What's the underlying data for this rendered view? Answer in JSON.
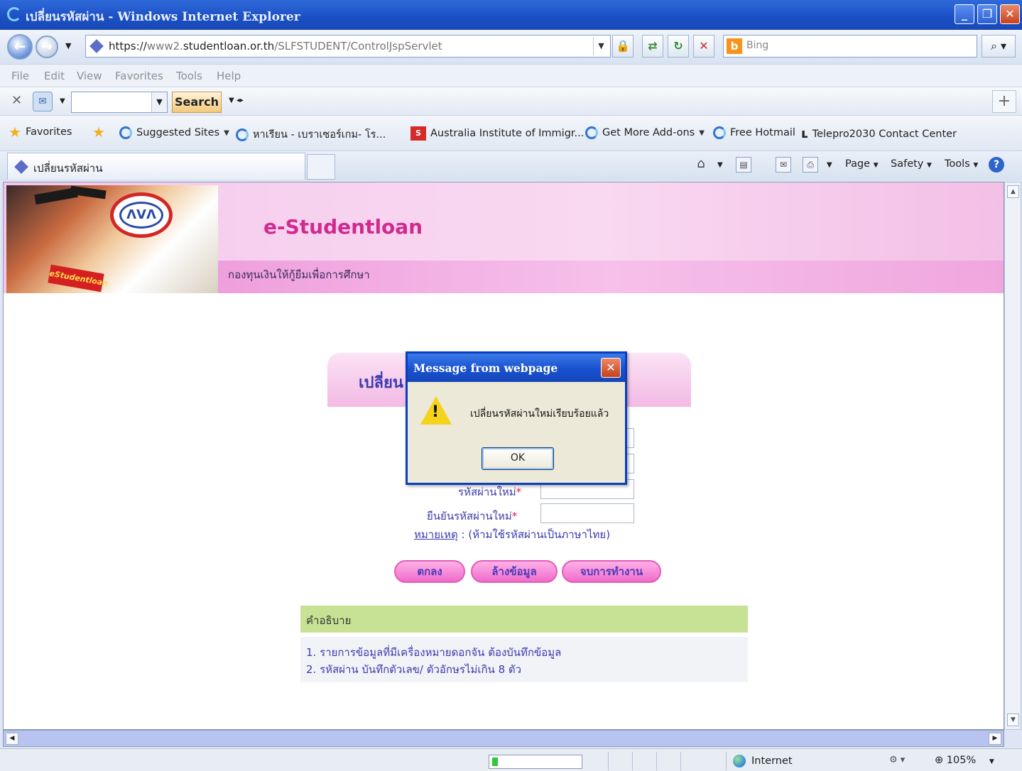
{
  "window": {
    "title": "เปลี่ยนรหัสผ่าน - Windows Internet Explorer",
    "minimize": "_",
    "restore": "❐",
    "close": "✕"
  },
  "address": {
    "url_host_prefix": "https://",
    "url_dim1": "www2.",
    "url_host": "studentloan.or.th",
    "url_path": "/SLFSTUDENT/ControlJspServlet",
    "bing_placeholder": "Bing"
  },
  "menu": [
    "File",
    "Edit",
    "View",
    "Favorites",
    "Tools",
    "Help"
  ],
  "toolbar": {
    "search_label": "Search"
  },
  "favorites": {
    "label": "Favorites",
    "items": [
      "Suggested Sites",
      "หาเรียน - เบราเซอร์เกม- โร...",
      "Australia Institute of Immigr...",
      "Get More Add-ons",
      "Free Hotmail",
      "Telepro2030 Contact Center"
    ]
  },
  "tab": {
    "label": "เปลี่ยนรหัสผ่าน"
  },
  "commands": {
    "page": "Page",
    "safety": "Safety",
    "tools": "Tools"
  },
  "banner": {
    "brand": "e-Studentloan",
    "subtitle": "กองทุนเงินให้กู้ยืมเพื่อการศึกษา",
    "badge": "eStudentloan",
    "logo_text": "ΛVΛ"
  },
  "form": {
    "title": "เปลี่ยน",
    "new_password_label": "รหัสผ่านใหม่",
    "confirm_password_label": "ยืนยันรหัสผ่านใหม่",
    "required_mark": "*",
    "note_link": "หมายเหตุ",
    "note_text": " : (ห้ามใช้รหัสผ่านเป็นภาษาไทย)",
    "btn_ok": "ตกลง",
    "btn_clear": "ล้างข้อมูล",
    "btn_exit": "จบการทำงาน"
  },
  "description": {
    "header": "คำอธิบาย",
    "lines": [
      "1. รายการข้อมูลที่มีเครื่องหมายดอกจัน ต้องบันทึกข้อมูล",
      "2. รหัสผ่าน บันทึกตัวเลข/ ตัวอักษรไม่เกิน 8 ตัว"
    ]
  },
  "dialog": {
    "title": "Message from webpage",
    "message": "เปลี่ยนรหัสผ่านใหม่เรียบร้อยแล้ว",
    "ok_label": "OK"
  },
  "status": {
    "zone": "Internet",
    "zoom": "105%"
  }
}
